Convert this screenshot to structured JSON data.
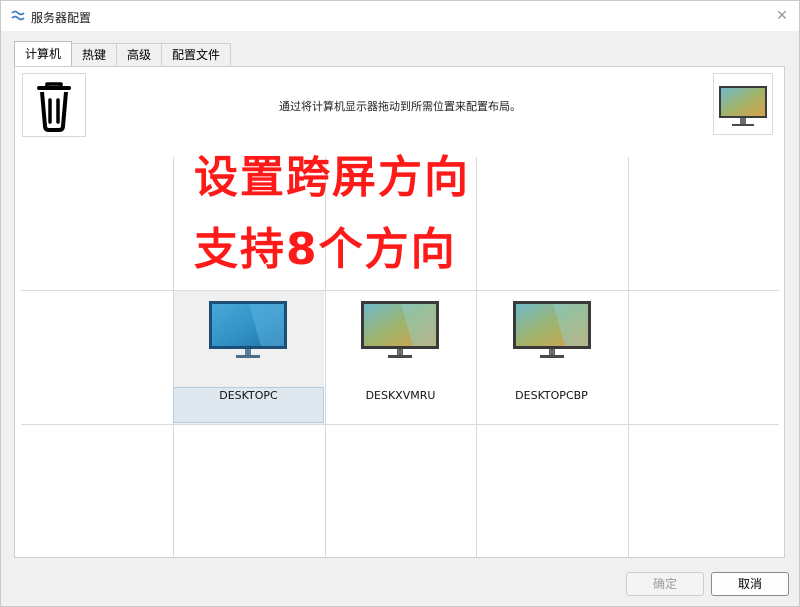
{
  "window": {
    "title": "服务器配置",
    "close_glyph": "✕"
  },
  "tabs": [
    {
      "label": "计算机",
      "active": true
    },
    {
      "label": "热键",
      "active": false
    },
    {
      "label": "高级",
      "active": false
    },
    {
      "label": "配置文件",
      "active": false
    }
  ],
  "panel": {
    "instruction": "通过将计算机显示器拖动到所需位置来配置布局。",
    "trash_icon": "trash-icon",
    "tray_icon": "monitor-icon"
  },
  "overlay": {
    "line1": "设置跨屏方向",
    "line2": "支持8个方向",
    "color": "#ff1a1a"
  },
  "screens": [
    {
      "name": "DESKTOPC",
      "selected": true
    },
    {
      "name": "DESKXVMRU",
      "selected": false
    },
    {
      "name": "DESKTOPCBP",
      "selected": false
    }
  ],
  "footer": {
    "ok_label": "确定",
    "cancel_label": "取消"
  }
}
